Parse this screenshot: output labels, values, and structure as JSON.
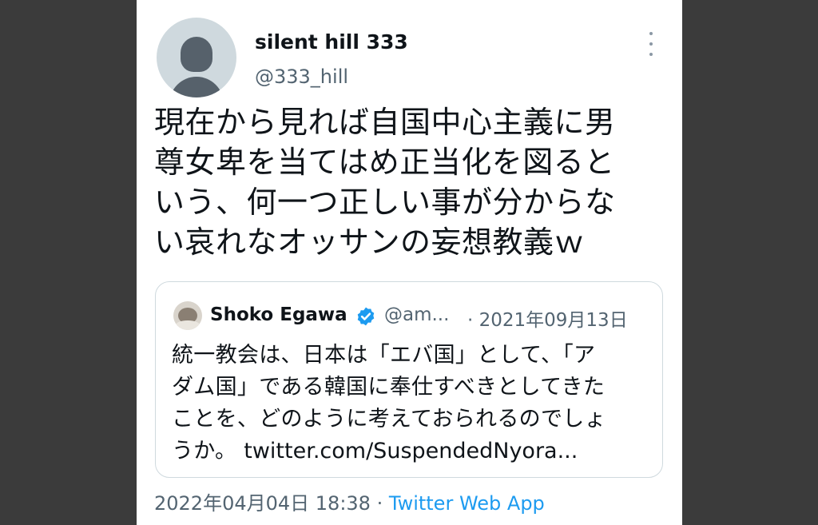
{
  "tweet": {
    "author_name": "silent hill 333",
    "author_handle": "@333_hill",
    "text_lines": [
      "現在から見れば自国中心主義に男",
      "尊女卑を当てはめ正当化を図ると",
      "いう、何一つ正しい事が分からな",
      "い哀れなオッサンの妄想教義ｗ"
    ],
    "timestamp": "2022年04月04日 18:38",
    "separator": "·",
    "source": "Twitter Web App"
  },
  "quoted": {
    "author_name": "Shoko Egawa",
    "author_handle": "@am...",
    "date": "· 2021年09月13日",
    "text_lines": [
      "統一教会は、日本は「エバ国」として、「ア",
      "ダム国」である韓国に奉仕すべきとしてきた",
      "ことを、どのように考えておられるのでしょ"
    ],
    "last_line_prefix": "うか。",
    "link": "twitter.com/SuspendedNyora..."
  },
  "icons": {
    "more": "more-vertical-icon",
    "verified": "verified-badge-icon",
    "avatar": "default-avatar-icon"
  },
  "colors": {
    "background": "#3b3b3b",
    "card": "#ffffff",
    "link": "#1d9bf0",
    "verified": "#1d9bf0",
    "secondary_text": "#536471"
  }
}
